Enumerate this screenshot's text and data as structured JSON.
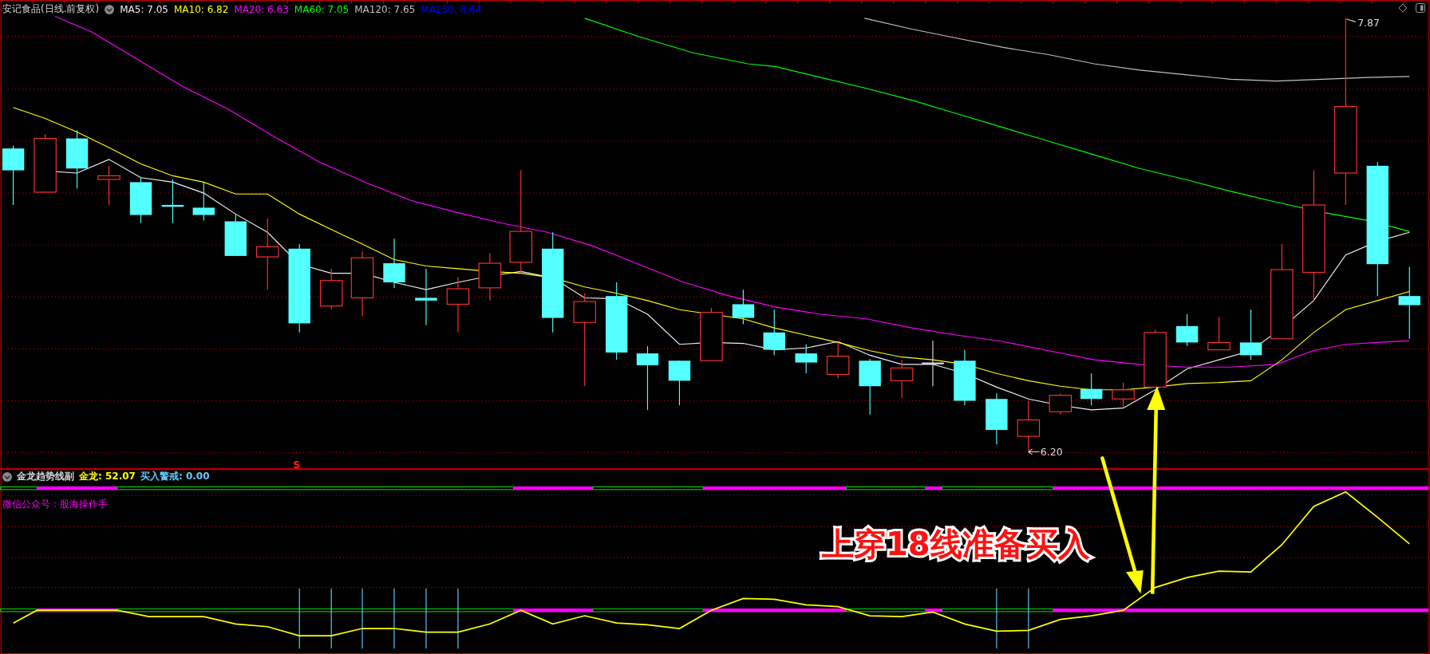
{
  "chart": {
    "title": "安记食品(日线.前复权)",
    "moving_averages": [
      {
        "label": "MA5: 7.05",
        "color": "#f0f0f0"
      },
      {
        "label": "MA10: 6.82",
        "color": "#ffff00"
      },
      {
        "label": "MA20: 6.63",
        "color": "#ff00ff"
      },
      {
        "label": "MA60: 7.05",
        "color": "#00ff00"
      },
      {
        "label": "MA120: 7.65",
        "color": "#c0c0c0"
      },
      {
        "label": "MA250: 8.64",
        "color": "#0000ff"
      }
    ],
    "high_label": "7.87",
    "low_label": "6.20",
    "signal_marker": "S"
  },
  "indicator": {
    "name": "金龙趋势线副",
    "values": [
      {
        "label": "金龙: 52.07",
        "color": "#ffff00"
      },
      {
        "label": "买入警戒: 0.00",
        "color": "#66ccff"
      }
    ],
    "note": "微信公众号：股海操作手"
  },
  "annotation": {
    "text": "上穿18线准备买入"
  }
}
